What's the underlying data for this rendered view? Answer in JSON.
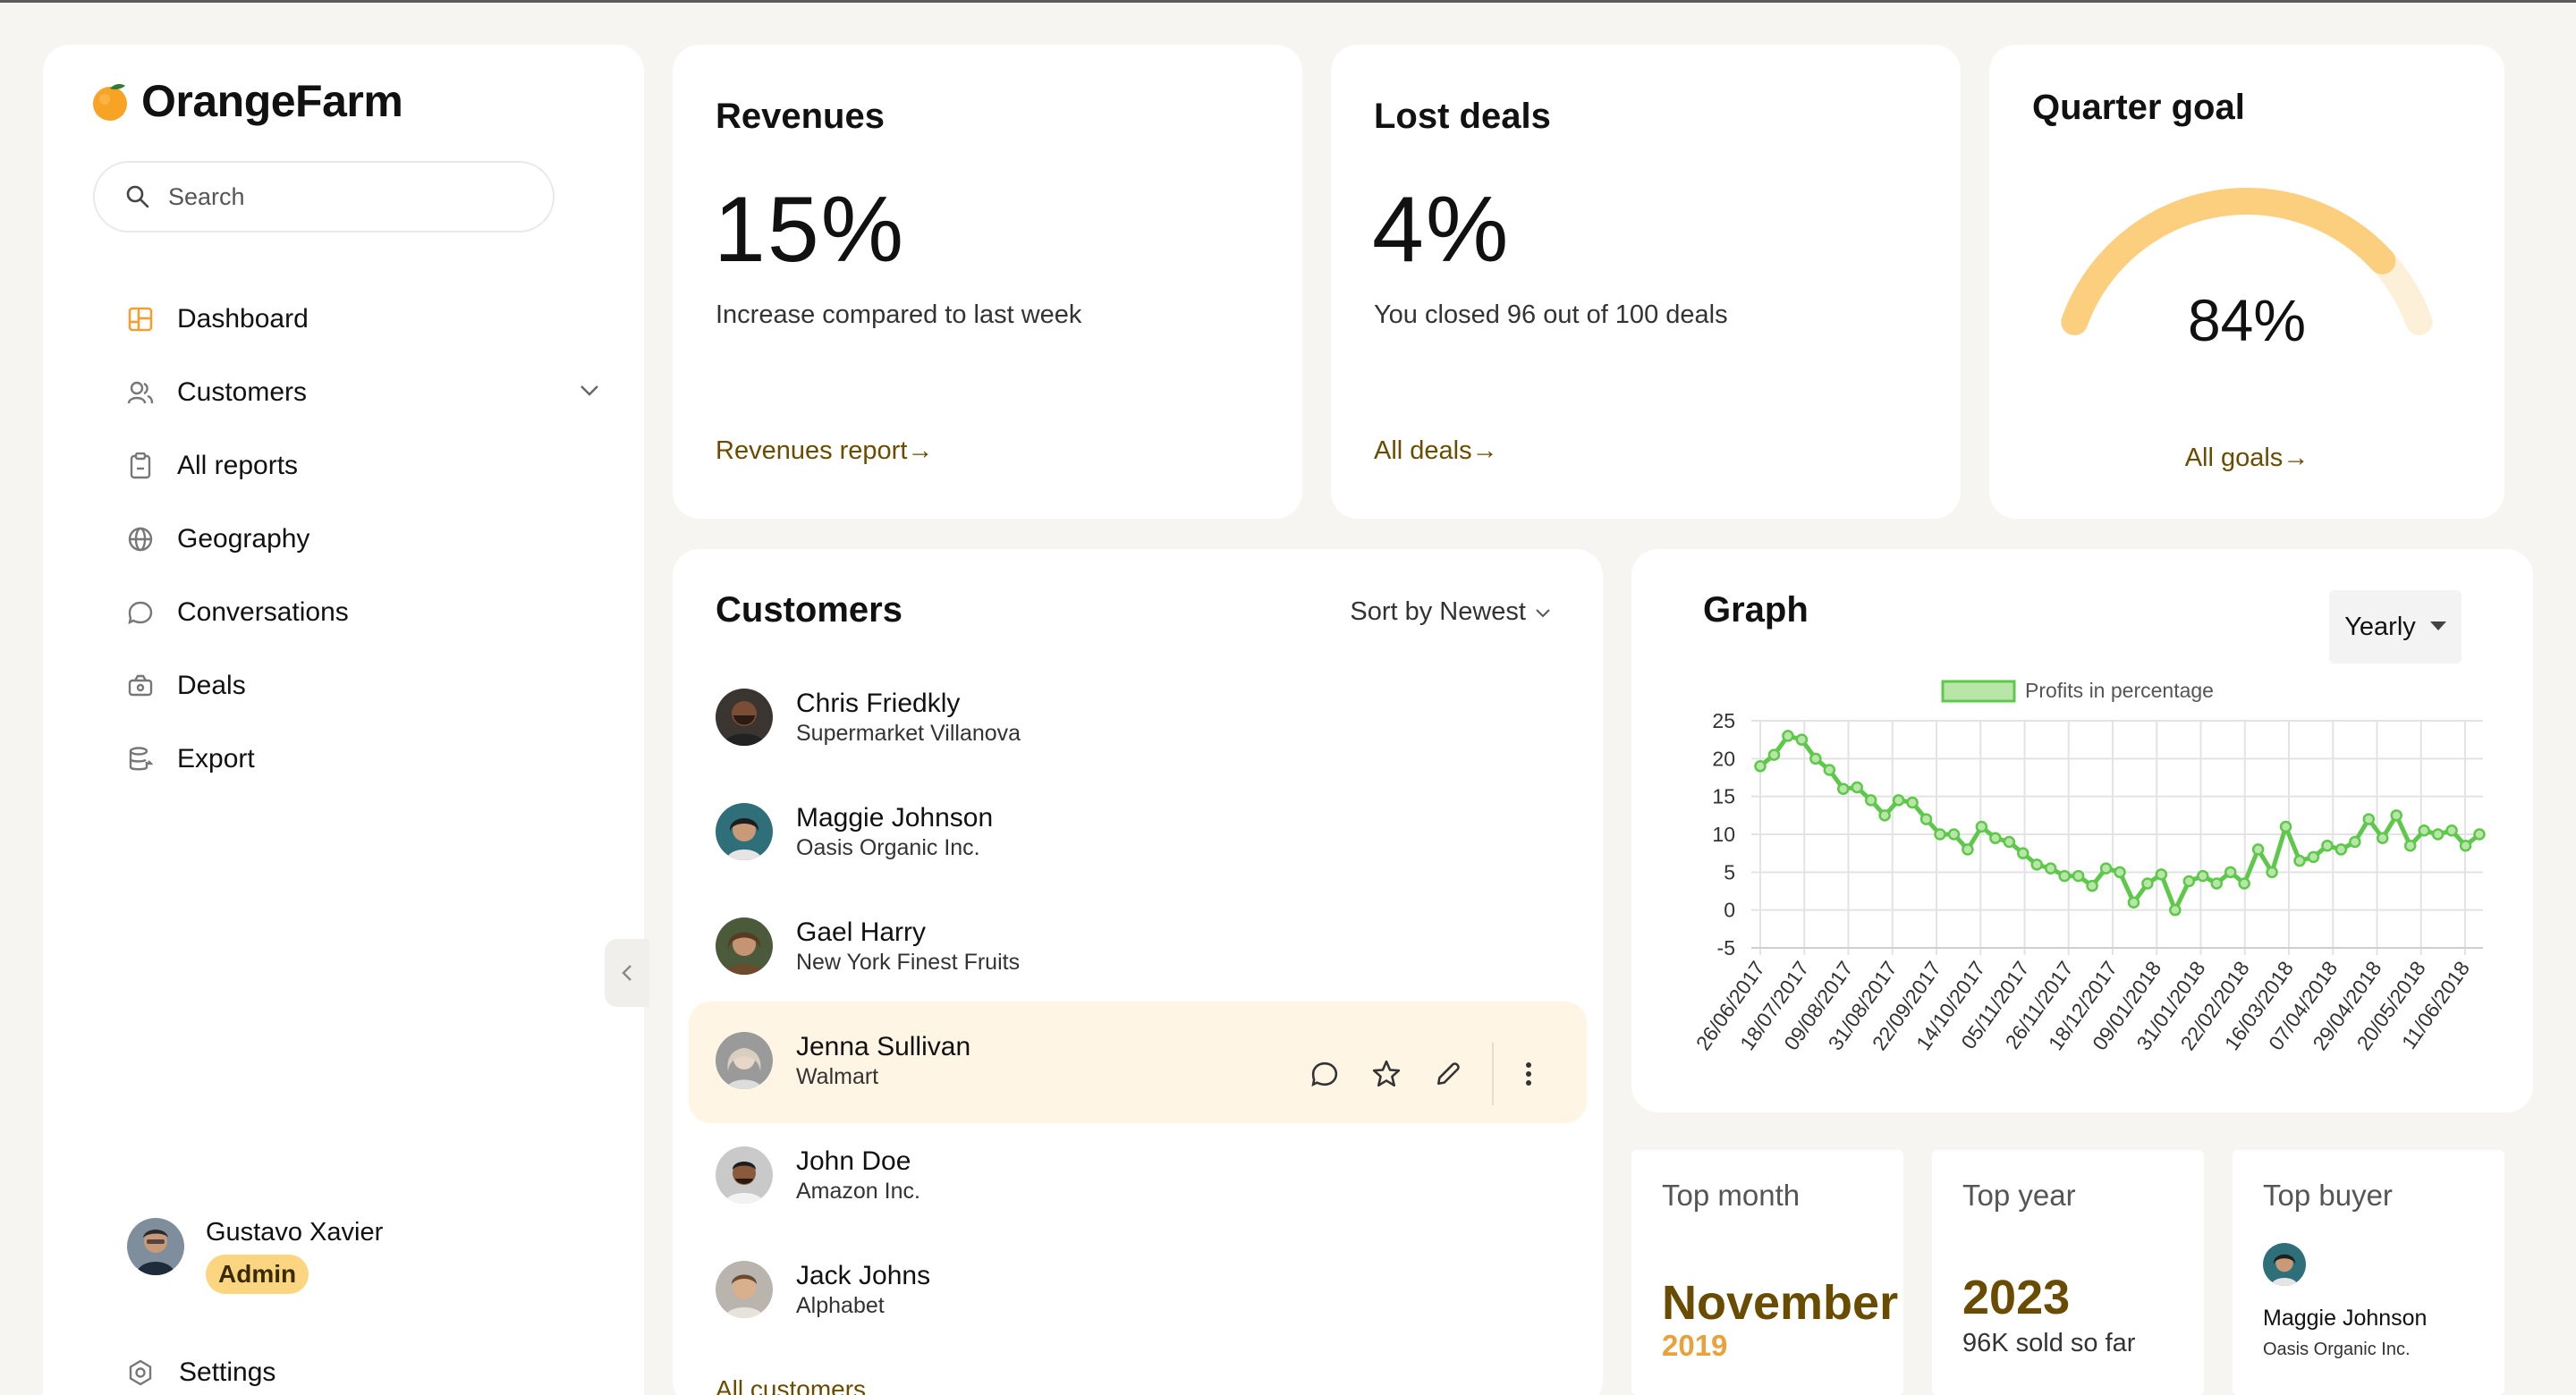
{
  "app": {
    "name": "OrangeFarm"
  },
  "search": {
    "placeholder": "Search"
  },
  "nav": {
    "items": [
      {
        "label": "Dashboard",
        "icon": "dashboard-icon"
      },
      {
        "label": "Customers",
        "icon": "users-icon"
      },
      {
        "label": "All reports",
        "icon": "clipboard-icon"
      },
      {
        "label": "Geography",
        "icon": "globe-icon"
      },
      {
        "label": "Conversations",
        "icon": "chat-icon"
      },
      {
        "label": "Deals",
        "icon": "deals-icon"
      },
      {
        "label": "Export",
        "icon": "export-icon"
      }
    ],
    "settings": "Settings"
  },
  "user": {
    "name": "Gustavo Xavier",
    "role": "Admin"
  },
  "revenues": {
    "title": "Revenues",
    "value": "15%",
    "subtitle": "Increase compared to last week",
    "link": "Revenues report"
  },
  "lost_deals": {
    "title": "Lost deals",
    "value": "4%",
    "subtitle": "You closed 96 out of 100 deals",
    "link": "All deals"
  },
  "quarter_goal": {
    "title": "Quarter goal",
    "value": "84%",
    "progress": 0.84,
    "link": "All goals"
  },
  "customers": {
    "title": "Customers",
    "sort_label": "Sort by Newest",
    "rows": [
      {
        "name": "Chris Friedkly",
        "company": "Supermarket Villanova"
      },
      {
        "name": "Maggie Johnson",
        "company": "Oasis Organic Inc."
      },
      {
        "name": "Gael Harry",
        "company": "New York Finest Fruits"
      },
      {
        "name": "Jenna Sullivan",
        "company": "Walmart"
      },
      {
        "name": "John Doe",
        "company": "Amazon Inc."
      },
      {
        "name": "Jack Johns",
        "company": "Alphabet"
      }
    ],
    "all_link": "All customers"
  },
  "graph": {
    "title": "Graph",
    "period": "Yearly"
  },
  "chart_data": {
    "type": "line",
    "legend": "Profits in percentage",
    "ylim": [
      -5,
      25
    ],
    "yticks": [
      -5,
      0,
      5,
      10,
      15,
      20,
      25
    ],
    "xtick_labels": [
      "26/06/2017",
      "18/07/2017",
      "09/08/2017",
      "31/08/2017",
      "22/09/2017",
      "14/10/2017",
      "05/11/2017",
      "26/11/2017",
      "18/12/2017",
      "09/01/2018",
      "31/01/2018",
      "22/02/2018",
      "16/03/2018",
      "07/04/2018",
      "29/04/2018",
      "20/05/2018",
      "11/06/2018"
    ],
    "series": [
      {
        "name": "Profits in percentage",
        "values": [
          19,
          20.5,
          23,
          22.5,
          20,
          18.5,
          16,
          16.2,
          14.5,
          12.5,
          14.5,
          14.2,
          12,
          10,
          10,
          8,
          11,
          9.5,
          9,
          7.5,
          6,
          5.5,
          4.5,
          4.5,
          3.2,
          5.5,
          5,
          1,
          3.5,
          4.7,
          0,
          3.8,
          4.5,
          3.5,
          5,
          3.5,
          8,
          5,
          11,
          6.5,
          7,
          8.5,
          8,
          9,
          12,
          9.5,
          12.5,
          8.5,
          10.5,
          10,
          10.5,
          8.5,
          10
        ]
      }
    ],
    "colors": {
      "line": "#5ec84a",
      "fill": "#b8e6a8"
    }
  },
  "top_month": {
    "title": "Top month",
    "month": "November",
    "year": "2019"
  },
  "top_year": {
    "title": "Top year",
    "year": "2023",
    "subtitle": "96K sold so far"
  },
  "top_buyer": {
    "title": "Top buyer",
    "name": "Maggie Johnson",
    "company": "Oasis Organic Inc."
  }
}
